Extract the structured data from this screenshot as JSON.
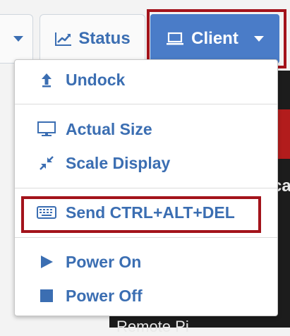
{
  "toolbar": {
    "status_label": "Status",
    "client_label": "Client"
  },
  "background": {
    "sliver_text": "ca",
    "bottom_text": "Remote Pi"
  },
  "menu": {
    "undock": "Undock",
    "actual_size": "Actual Size",
    "scale_display": "Scale Display",
    "send_cad": "Send CTRL+ALT+DEL",
    "power_on": "Power On",
    "power_off": "Power Off"
  },
  "colors": {
    "accent": "#3b6eb2",
    "client_button": "#4a7cc8",
    "highlight_outline": "#a3131b"
  },
  "icons": [
    "chevron-down-icon",
    "chart-line-icon",
    "laptop-icon",
    "upload-arrow-icon",
    "monitor-icon",
    "compress-icon",
    "keyboard-icon",
    "play-icon",
    "square-icon"
  ]
}
